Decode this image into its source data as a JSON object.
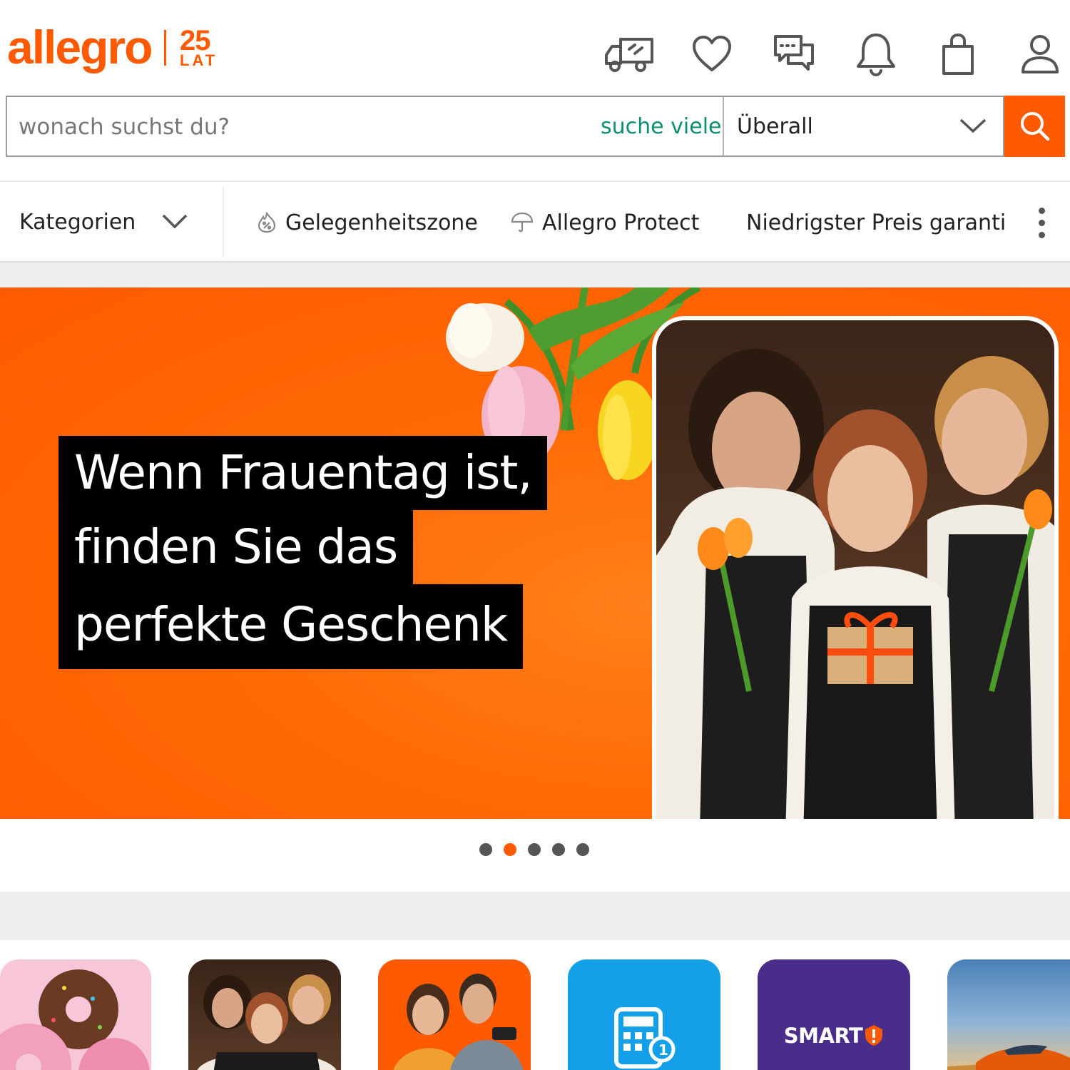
{
  "header": {
    "logo_text": "allegro",
    "anniversary_number": "25",
    "anniversary_suffix": "LAT",
    "icons": [
      "delivery-truck-icon",
      "heart-icon",
      "chat-icon",
      "bell-icon",
      "shopping-bag-icon",
      "user-icon"
    ]
  },
  "search": {
    "placeholder": "wonach suchst du?",
    "value": "",
    "suggestion_link": "suche viele",
    "scope_selected": "Überall"
  },
  "nav": {
    "categories_label": "Kategorien",
    "links": [
      {
        "label": "Gelegenheitszone",
        "icon": "percent-flame-icon"
      },
      {
        "label": "Allegro Protect",
        "icon": "umbrella-icon"
      },
      {
        "label": "Niedrigster Preis garanti",
        "icon": "badge-check-icon"
      }
    ]
  },
  "hero": {
    "headline_lines": [
      "Wenn Frauentag ist,",
      "finden Sie das",
      "perfekte Geschenk"
    ],
    "slide_count": 5,
    "active_slide": 2
  },
  "tiles": {
    "smart_label": "SMART"
  },
  "colors": {
    "brand_orange": "#ff5a00",
    "suggestion_green": "#0b8f73",
    "smart_purple": "#4a2c8a",
    "calculator_blue": "#14a0e8"
  }
}
